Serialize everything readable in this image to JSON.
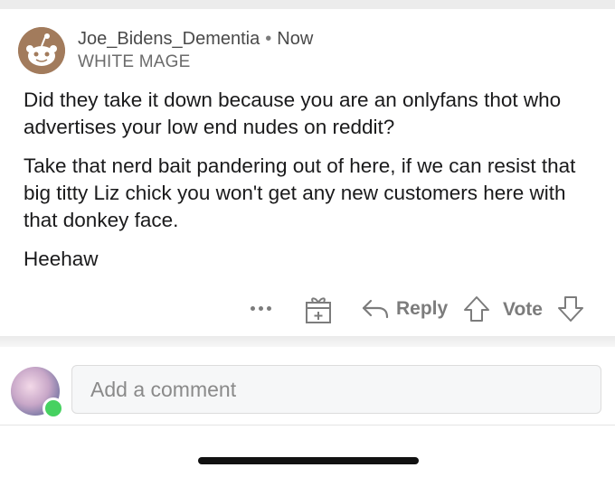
{
  "comment": {
    "author": "Joe_Bidens_Dementia",
    "separator": "•",
    "time": "Now",
    "flair": "WHITE MAGE",
    "paragraphs": [
      "Did they take it down because you are an onlyfans thot who advertises your low end nudes on reddit?",
      "Take that nerd bait pandering out of here, if we can resist that big titty Liz chick you won't get any new customers here with that donkey face.",
      "Heehaw"
    ],
    "actions": {
      "more_icon": "more-horizontal-icon",
      "gift_icon": "gift-award-icon",
      "reply_icon": "reply-arrow-icon",
      "reply_label": "Reply",
      "upvote_icon": "upvote-arrow-icon",
      "vote_label": "Vote",
      "downvote_icon": "downvote-arrow-icon"
    }
  },
  "composer": {
    "placeholder": "Add a comment",
    "online_status_color": "#46d160"
  }
}
